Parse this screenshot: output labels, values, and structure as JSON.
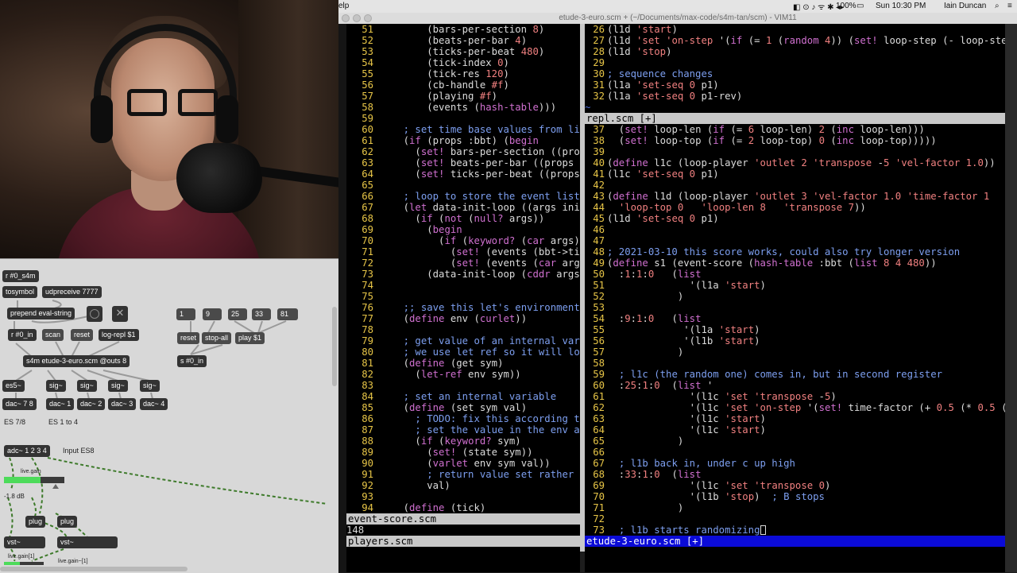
{
  "menubar": {
    "app_fragment": "elp",
    "battery": "100%",
    "datetime": "Sun 10:30 PM",
    "user": "Iain Duncan"
  },
  "window": {
    "title": "etude-3-euro.scm + (~/Documents/max-code/s4m-tan/scm) - VIM11"
  },
  "patcher": {
    "objects": {
      "r_s4m": "r #0_s4m",
      "tosymbol": "tosymbol",
      "udpreceive": "udpreceive 7777",
      "prepend": "prepend eval-string",
      "r_in": "r #0_in",
      "scan": "scan",
      "reset1": "reset",
      "logrepl": "log-repl $1",
      "n1": "1",
      "n9": "9",
      "n25": "25",
      "n33": "33",
      "n81": "81",
      "reset2": "reset",
      "stopall": "stop-all",
      "play": "play $1",
      "s_in": "s #0_in",
      "s4m": "s4m etude-3-euro.scm @outs 8",
      "es5": "es5~",
      "sig1": "sig~",
      "sig2": "sig~",
      "sig3": "sig~",
      "sig4": "sig~",
      "dac78": "dac~ 7 8",
      "dac1": "dac~ 1",
      "dac2": "dac~ 2",
      "dac3": "dac~ 3",
      "dac4": "dac~ 4",
      "adc": "adc~ 1 2 3 4",
      "plug1": "plug",
      "plug2": "plug",
      "vst1": "vst~",
      "vst2": "vst~"
    },
    "labels": {
      "es78": "ES 7/8",
      "es1to4": "ES 1 to 4",
      "input": "Input  ES8",
      "livegain": "live.gain",
      "db": "-1.8 dB",
      "livegain1": "live.gain[1]",
      "livegain2": "live.gain~[1]"
    },
    "gain_level": 0.6
  },
  "vim": {
    "left_pane": {
      "lines": [
        {
          "n": "51",
          "code": "        (bars-per-section 8)"
        },
        {
          "n": "52",
          "code": "        (beats-per-bar 4)"
        },
        {
          "n": "53",
          "code": "        (ticks-per-beat 480)"
        },
        {
          "n": "54",
          "code": "        (tick-index 0)"
        },
        {
          "n": "55",
          "code": "        (tick-res 120)"
        },
        {
          "n": "56",
          "code": "        (cb-handle #f)"
        },
        {
          "n": "57",
          "code": "        (playing #f)"
        },
        {
          "n": "58",
          "code": "        (events (hash-table)))"
        },
        {
          "n": "59",
          "code": ""
        },
        {
          "n": "60",
          "code": "    ; set time base values from list"
        },
        {
          "n": "61",
          "code": "    (if (props :bbt) (begin"
        },
        {
          "n": "62",
          "code": "      (set! bars-per-section ((props"
        },
        {
          "n": "63",
          "code": "      (set! beats-per-bar ((props :b"
        },
        {
          "n": "64",
          "code": "      (set! ticks-per-beat ((props :"
        },
        {
          "n": "65",
          "code": ""
        },
        {
          "n": "66",
          "code": "    ; loop to store the event list f"
        },
        {
          "n": "67",
          "code": "    (let data-init-loop ((args init-"
        },
        {
          "n": "68",
          "code": "      (if (not (null? args))"
        },
        {
          "n": "69",
          "code": "        (begin"
        },
        {
          "n": "70",
          "code": "          (if (keyword? (car args))"
        },
        {
          "n": "71",
          "code": "            (set! (events (bbt->tick"
        },
        {
          "n": "72",
          "code": "            (set! (events (car args)"
        },
        {
          "n": "73",
          "code": "        (data-init-loop (cddr args))"
        },
        {
          "n": "74",
          "code": ""
        },
        {
          "n": "75",
          "code": ""
        },
        {
          "n": "76",
          "code": "    ;; save this let's environment a"
        },
        {
          "n": "77",
          "code": "    (define env (curlet))"
        },
        {
          "n": "78",
          "code": ""
        },
        {
          "n": "79",
          "code": "    ; get value of an internal var f"
        },
        {
          "n": "80",
          "code": "    ; we use let ref so it will look"
        },
        {
          "n": "81",
          "code": "    (define (get sym)"
        },
        {
          "n": "82",
          "code": "      (let-ref env sym))"
        },
        {
          "n": "83",
          "code": ""
        },
        {
          "n": "84",
          "code": "    ; set an internal variable"
        },
        {
          "n": "85",
          "code": "    (define (set sym val)"
        },
        {
          "n": "86",
          "code": "      ; TODO: fix this according to"
        },
        {
          "n": "87",
          "code": "      ; set the value in the env and"
        },
        {
          "n": "88",
          "code": "      (if (keyword? sym)"
        },
        {
          "n": "89",
          "code": "        (set! (state sym))"
        },
        {
          "n": "90",
          "code": "        (varlet env sym val))"
        },
        {
          "n": "91",
          "code": "        ; return value set rather th"
        },
        {
          "n": "92",
          "code": "        val)"
        },
        {
          "n": "93",
          "code": ""
        },
        {
          "n": "94",
          "code": "    (define (tick)"
        }
      ],
      "status": "event-score.scm",
      "lower_line": "148",
      "lower_status": "players.scm"
    },
    "right_top_pane": {
      "lines": [
        {
          "n": "26",
          "code": "(l1d 'start)"
        },
        {
          "n": "27",
          "code": "(l1d 'set 'on-step '(if (= 1 (random 4)) (set! loop-step (- loop-ste"
        },
        {
          "n": "28",
          "code": "(l1d 'stop)"
        },
        {
          "n": "29",
          "code": ""
        },
        {
          "n": "30",
          "code": "; sequence changes"
        },
        {
          "n": "31",
          "code": "(l1a 'set-seq 0 p1)"
        },
        {
          "n": "32",
          "code": "(l1a 'set-seq 0 p1-rev)"
        }
      ],
      "tilde": "~",
      "status": "repl.scm [+]"
    },
    "right_main_pane": {
      "lines": [
        {
          "n": "37",
          "code": "  (set! loop-len (if (= 6 loop-len) 2 (inc loop-len)))"
        },
        {
          "n": "38",
          "code": "  (set! loop-top (if (= 2 loop-top) 0 (inc loop-top)))))"
        },
        {
          "n": "39",
          "code": ""
        },
        {
          "n": "40",
          "code": "(define l1c (loop-player 'outlet 2 'transpose -5 'vel-factor 1.0))"
        },
        {
          "n": "41",
          "code": "(l1c 'set-seq 0 p1)"
        },
        {
          "n": "42",
          "code": ""
        },
        {
          "n": "43",
          "code": "(define l1d (loop-player 'outlet 3 'vel-factor 1.0 'time-factor 1"
        },
        {
          "n": "44",
          "code": "  'loop-top 0   'loop-len 8   'transpose 7))"
        },
        {
          "n": "45",
          "code": "(l1d 'set-seq 0 p1)"
        },
        {
          "n": "46",
          "code": ""
        },
        {
          "n": "47",
          "code": ""
        },
        {
          "n": "48",
          "code": "; 2021-03-10 this score works, could also try longer version"
        },
        {
          "n": "49",
          "code": "(define s1 (event-score (hash-table :bbt (list 8 4 480))"
        },
        {
          "n": "50",
          "code": "  :1:1:0   (list"
        },
        {
          "n": "51",
          "code": "              '(l1a 'start)"
        },
        {
          "n": "52",
          "code": "            )"
        },
        {
          "n": "53",
          "code": ""
        },
        {
          "n": "54",
          "code": "  :9:1:0   (list"
        },
        {
          "n": "55",
          "code": "             '(l1a 'start)"
        },
        {
          "n": "56",
          "code": "             '(l1b 'start)"
        },
        {
          "n": "57",
          "code": "            )"
        },
        {
          "n": "58",
          "code": ""
        },
        {
          "n": "59",
          "code": "  ; l1c (the random one) comes in, but in second register"
        },
        {
          "n": "60",
          "code": "  :25:1:0  (list '"
        },
        {
          "n": "61",
          "code": "              '(l1c 'set 'transpose -5)"
        },
        {
          "n": "62",
          "code": "              '(l1c 'set 'on-step '(set! time-factor (+ 0.5 (* 0.5 ("
        },
        {
          "n": "63",
          "code": "              '(l1c 'start)"
        },
        {
          "n": "64",
          "code": "              '(l1c 'start)"
        },
        {
          "n": "65",
          "code": "            )"
        },
        {
          "n": "66",
          "code": ""
        },
        {
          "n": "67",
          "code": "  ; l1b back in, under c up high"
        },
        {
          "n": "68",
          "code": "  :33:1:0  (list"
        },
        {
          "n": "69",
          "code": "              '(l1c 'set 'transpose 0)"
        },
        {
          "n": "70",
          "code": "              '(l1b 'stop)  ; B stops"
        },
        {
          "n": "71",
          "code": "            )"
        },
        {
          "n": "72",
          "code": ""
        },
        {
          "n": "73",
          "code": "  ; l1b starts randomizing"
        }
      ],
      "status": "etude-3-euro.scm [+]"
    }
  },
  "colors": {
    "line_number": "#e7c547",
    "comment": "#7d9ff0",
    "keyword": "#d070d0",
    "symbol": "#f08080",
    "active_status": "#0b0bd8"
  }
}
